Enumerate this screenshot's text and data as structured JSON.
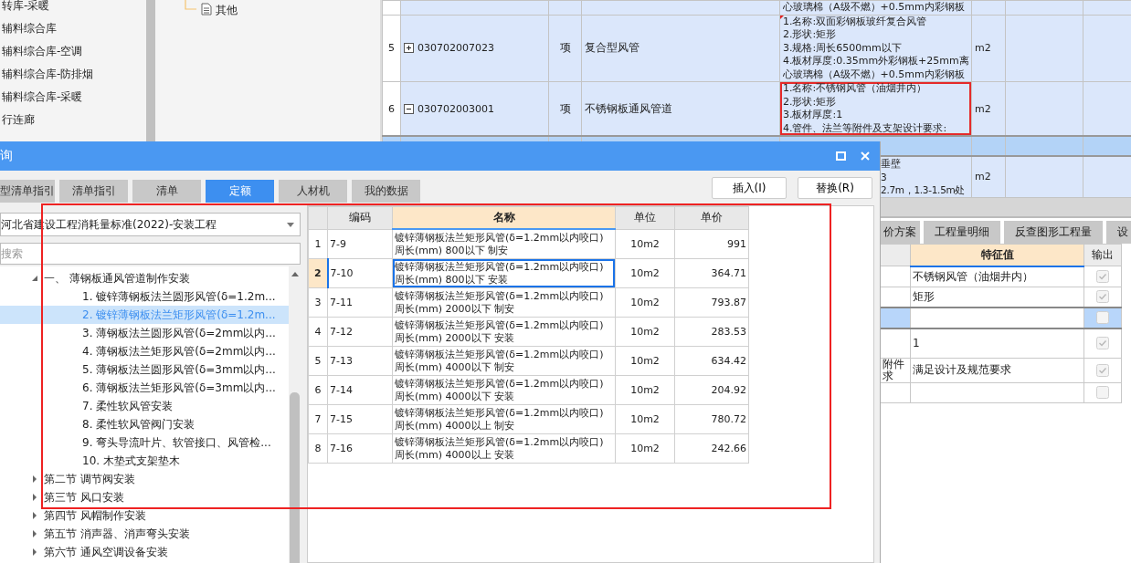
{
  "nav_tree": {
    "items": [
      {
        "label": "转库-采暖"
      },
      {
        "label": "辅料综合库"
      },
      {
        "label": "辅料综合库-空调"
      },
      {
        "label": "辅料综合库-防排烟"
      },
      {
        "label": "辅料综合库-采暖"
      },
      {
        "label": "行连廊"
      }
    ]
  },
  "folder_tree": {
    "items": [
      {
        "label": "其他"
      }
    ]
  },
  "bill_table": {
    "rows": [
      {
        "selected": false,
        "features": [
          "心玻璃棉（A级不燃）+0.5mm内彩钢板"
        ]
      },
      {
        "selected": false,
        "number": "5",
        "code": "030702007023",
        "expanded": false,
        "unit_type": "项",
        "name": "复合型风管",
        "features": [
          "1.名称:双面彩钢板玻纤复合风管",
          "2.形状:矩形",
          "3.规格:周长6500mm以下",
          "4.板材厚度:0.35mm外彩钢板+25mm离",
          "心玻璃棉（A级不燃）+0.5mm内彩钢板"
        ],
        "unit": "m2",
        "commented": true,
        "flagged": false
      },
      {
        "selected": false,
        "number": "6",
        "code": "030702003001",
        "expanded": true,
        "unit_type": "项",
        "name": "不锈钢板通风管道",
        "features": [
          "1.名称:不锈钢风管（油烟井内）",
          "2.形状:矩形",
          "3.板材厚度:1",
          "4.管件、法兰等附件及支架设计要求:"
        ],
        "unit": "m2",
        "commented": false,
        "flagged": true
      },
      {
        "selected": true
      },
      {
        "selected": false,
        "features": [
          "垂壁",
          "3",
          "2.7m，1.3-1.5m处"
        ],
        "unit": "m2"
      }
    ]
  },
  "feature_panel": {
    "tabs": [
      "价方案",
      "工程量明细",
      "反查图形工程量",
      "设"
    ],
    "columns": [
      "特征值",
      "输出"
    ],
    "rows": [
      {
        "selected": false,
        "value": "不锈钢风管（油烟井内）",
        "output": true
      },
      {
        "selected": false,
        "value": "矩形",
        "output": true
      },
      {
        "selected": true,
        "output": false
      },
      {
        "selected": false,
        "value": "1",
        "output": true
      },
      {
        "selected": false,
        "name": [
          "附件",
          "求"
        ],
        "value": "满足设计及规范要求",
        "output": true
      },
      {
        "selected": false,
        "output": false
      }
    ]
  },
  "dialog": {
    "title": "询",
    "annotated": true,
    "tabs": [
      {
        "label": "型清单指引",
        "selected": false
      },
      {
        "label": "清单指引",
        "selected": false
      },
      {
        "label": "清单",
        "selected": false
      },
      {
        "label": "定额",
        "selected": true
      },
      {
        "label": "人材机",
        "selected": false
      },
      {
        "label": "我的数据",
        "selected": false
      }
    ],
    "buttons": [
      "插入(I)",
      "替换(R)"
    ],
    "library": "河北省建设工程消耗量标准(2022)-安装工程",
    "search": {
      "placeholder": "搜索"
    },
    "tree": [
      {
        "label": "一、  薄钢板通风管道制作安装",
        "expanded": true,
        "selected": false,
        "children": [
          {
            "label": "1. 镀锌薄钢板法兰圆形风管(δ=1.2m...",
            "selected": false
          },
          {
            "label": "2. 镀锌薄钢板法兰矩形风管(δ=1.2m...",
            "selected": true
          },
          {
            "label": "3. 薄钢板法兰圆形风管(δ=2mm以内...",
            "selected": false
          },
          {
            "label": "4. 薄钢板法兰矩形风管(δ=2mm以内...",
            "selected": false
          },
          {
            "label": "5. 薄钢板法兰圆形风管(δ=3mm以内...",
            "selected": false
          },
          {
            "label": "6. 薄钢板法兰矩形风管(δ=3mm以内...",
            "selected": false
          },
          {
            "label": "7. 柔性软风管安装",
            "selected": false
          },
          {
            "label": "8. 柔性软风管阀门安装",
            "selected": false
          },
          {
            "label": "9. 弯头导流叶片、软管接口、风管检...",
            "selected": false
          },
          {
            "label": "10. 木垫式支架垫木",
            "selected": false
          }
        ]
      },
      {
        "label": "第二节 调节阀安装",
        "expanded": false,
        "selected": false
      },
      {
        "label": "第三节 风口安装",
        "expanded": false,
        "selected": false
      },
      {
        "label": "第四节 风帽制作安装",
        "expanded": false,
        "selected": false
      },
      {
        "label": "第五节 消声器、消声弯头安装",
        "expanded": false,
        "selected": false
      },
      {
        "label": "第六节 通风空调设备安装",
        "expanded": false,
        "selected": false
      }
    ],
    "table": {
      "columns": [
        "编码",
        "名称",
        "单位",
        "单价"
      ],
      "rows": [
        {
          "number": "1",
          "code": "7-9",
          "name": "镀锌薄钢板法兰矩形风管(δ=1.2mm以内咬口)周长(mm) 800以下 制安",
          "unit": "10m2",
          "price": "991",
          "selected": false
        },
        {
          "number": "2",
          "code": "7-10",
          "name": "镀锌薄钢板法兰矩形风管(δ=1.2mm以内咬口)周长(mm) 800以下 安装",
          "unit": "10m2",
          "price": "364.71",
          "selected": true
        },
        {
          "number": "3",
          "code": "7-11",
          "name": "镀锌薄钢板法兰矩形风管(δ=1.2mm以内咬口)周长(mm) 2000以下 制安",
          "unit": "10m2",
          "price": "793.87",
          "selected": false
        },
        {
          "number": "4",
          "code": "7-12",
          "name": "镀锌薄钢板法兰矩形风管(δ=1.2mm以内咬口)周长(mm) 2000以下 安装",
          "unit": "10m2",
          "price": "283.53",
          "selected": false
        },
        {
          "number": "5",
          "code": "7-13",
          "name": "镀锌薄钢板法兰矩形风管(δ=1.2mm以内咬口)周长(mm) 4000以下 制安",
          "unit": "10m2",
          "price": "634.42",
          "selected": false
        },
        {
          "number": "6",
          "code": "7-14",
          "name": "镀锌薄钢板法兰矩形风管(δ=1.2mm以内咬口)周长(mm) 4000以下 安装",
          "unit": "10m2",
          "price": "204.92",
          "selected": false
        },
        {
          "number": "7",
          "code": "7-15",
          "name": "镀锌薄钢板法兰矩形风管(δ=1.2mm以内咬口)周长(mm) 4000以上 制安",
          "unit": "10m2",
          "price": "780.72",
          "selected": false
        },
        {
          "number": "8",
          "code": "7-16",
          "name": "镀锌薄钢板法兰矩形风管(δ=1.2mm以内咬口)周长(mm) 4000以上 安装",
          "unit": "10m2",
          "price": "242.66",
          "selected": false
        }
      ]
    }
  }
}
